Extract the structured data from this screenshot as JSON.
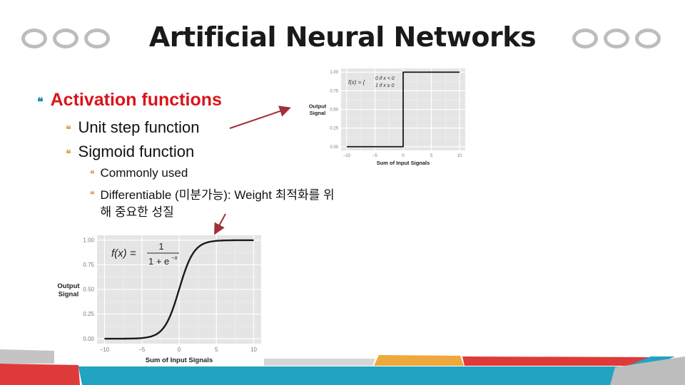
{
  "slide": {
    "title": "Artificial Neural Networks",
    "bullets": {
      "level1": "Activation functions",
      "level2": [
        "Unit step function",
        "Sigmoid function"
      ],
      "level3": [
        "Commonly used",
        "Differentiable (미분가능):  Weight 최적화를 위",
        "해 중요한 성질"
      ]
    },
    "bullet_glyph": "❝",
    "colors": {
      "heading_red": "#d9141c",
      "bullet_teal": "#1e8ea8",
      "bullet_gold": "#e0a858",
      "arrow": "#a0303a",
      "footer_red": "#de3a3a",
      "footer_teal": "#21a3c2",
      "footer_orange": "#eea83c",
      "footer_gray": "#bdbdbd"
    }
  },
  "chart_data": [
    {
      "type": "line",
      "name": "unit-step",
      "title": "",
      "formula": [
        "f(x) = {",
        "0 if x < 0",
        "1 if x ≥ 0"
      ],
      "xlabel": "Sum of Input Signals",
      "ylabel": [
        "Output",
        "Signal"
      ],
      "xlim": [
        -10,
        10
      ],
      "ylim": [
        0,
        1
      ],
      "xticks": [
        "-10",
        "-5",
        "0",
        "5",
        "10"
      ],
      "yticks": [
        "0.00",
        "0.25",
        "0.50",
        "0.75",
        "1.00"
      ],
      "grid": true,
      "x": [
        -10,
        0,
        0,
        10
      ],
      "y": [
        0,
        0,
        1,
        1
      ]
    },
    {
      "type": "line",
      "name": "sigmoid",
      "title": "",
      "formula": [
        "f(x) =",
        "1",
        "1 + e",
        "−x"
      ],
      "xlabel": "Sum of Input Signals",
      "ylabel": [
        "Output",
        "Signal"
      ],
      "xlim": [
        -10,
        10
      ],
      "ylim": [
        0,
        1
      ],
      "xticks": [
        "-10",
        "-5",
        "0",
        "5",
        "10"
      ],
      "yticks": [
        "0.00",
        "0.25",
        "0.50",
        "0.75",
        "1.00"
      ],
      "grid": true,
      "function": "1/(1+exp(-x))"
    }
  ]
}
